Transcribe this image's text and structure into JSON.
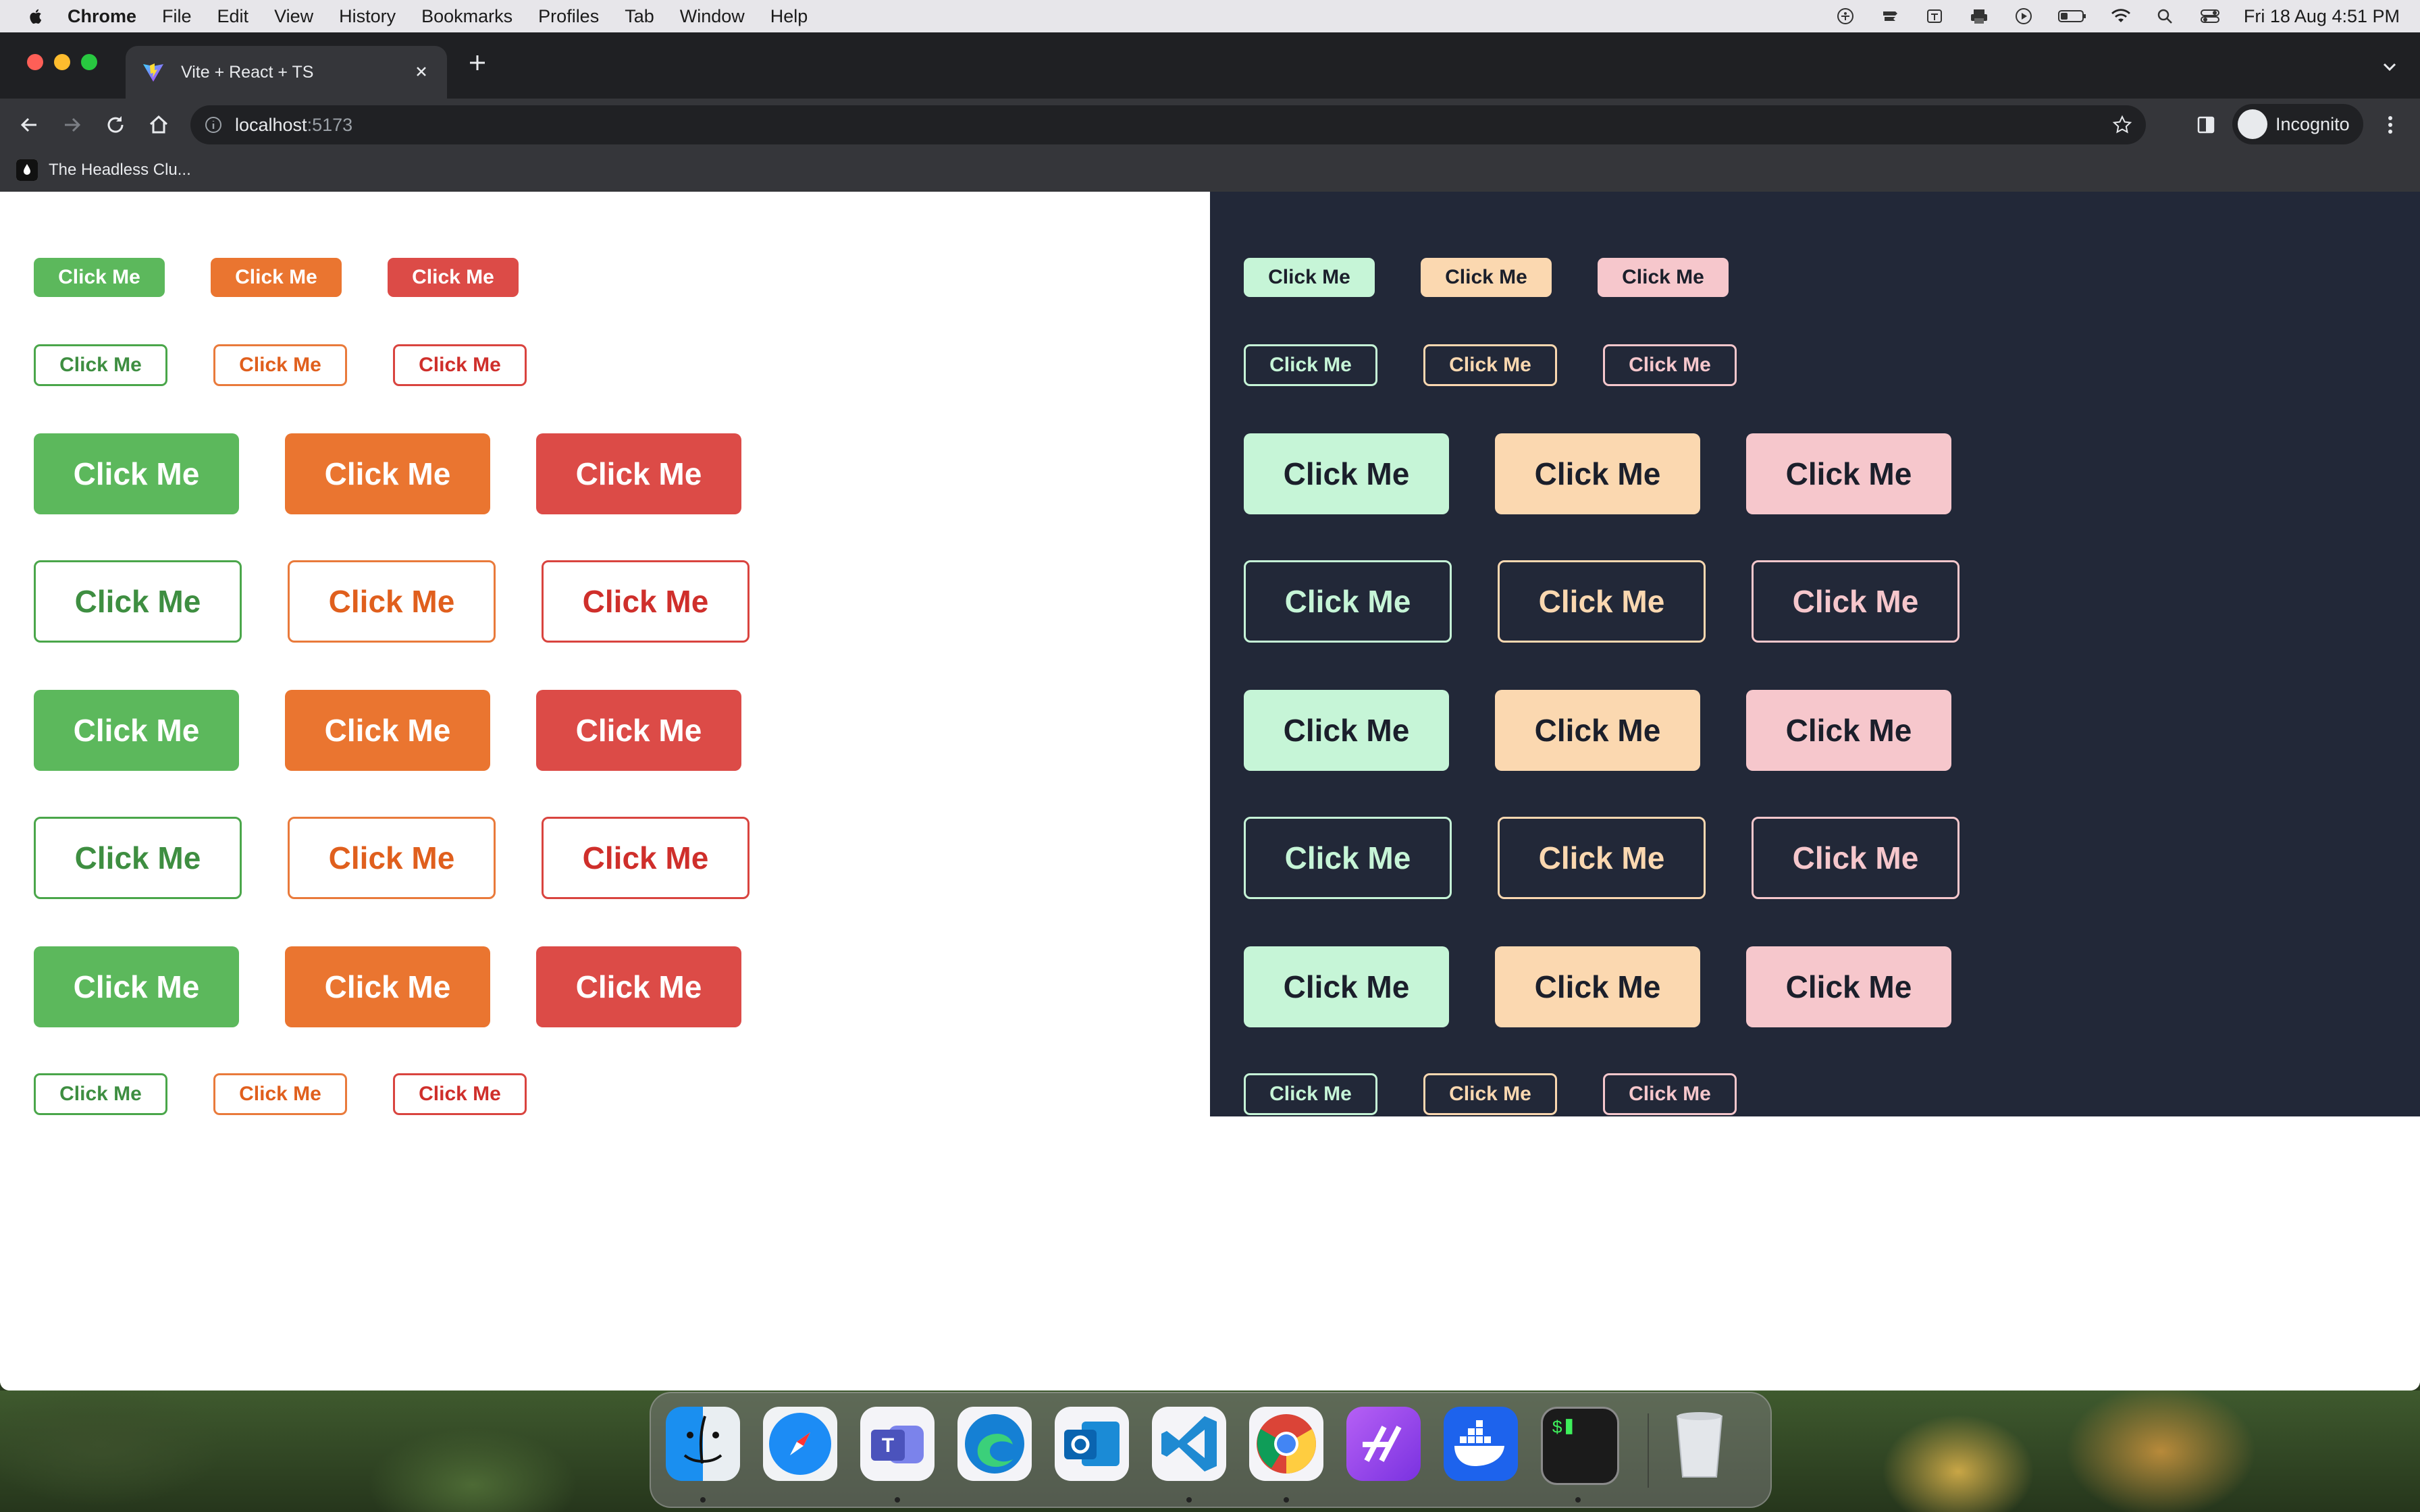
{
  "menubar": {
    "app": "Chrome",
    "items": [
      "File",
      "Edit",
      "View",
      "History",
      "Bookmarks",
      "Profiles",
      "Tab",
      "Window",
      "Help"
    ],
    "clock": "Fri 18 Aug  4:51 PM"
  },
  "browser": {
    "tab_title": "Vite + React + TS",
    "url_host": "localhost",
    "url_port": ":5173",
    "profile_label": "Incognito",
    "bookmark": "The Headless Clu..."
  },
  "button_label": "Click Me",
  "light_panel": {
    "rows": [
      {
        "size": "xs",
        "variant": "solid"
      },
      {
        "size": "sm",
        "variant": "outline"
      },
      {
        "size": "lg",
        "variant": "solid"
      },
      {
        "size": "lg",
        "variant": "outline"
      },
      {
        "size": "lg",
        "variant": "solid"
      },
      {
        "size": "lg",
        "variant": "outline"
      },
      {
        "size": "lg",
        "variant": "solid"
      },
      {
        "size": "sm",
        "variant": "outline"
      }
    ],
    "colors": {
      "green": "#5cb85c",
      "orange": "#ea7530",
      "red": "#dc4b47"
    }
  },
  "dark_panel": {
    "background": "#222838",
    "colors": {
      "green": "#c6f5d7",
      "orange": "#fbd8b0",
      "red": "#f6c7cc"
    }
  },
  "dock": {
    "apps": [
      "finder-icon",
      "safari-icon",
      "teams-icon",
      "edge-icon",
      "outlook-icon",
      "vscode-icon",
      "chrome-icon",
      "postman-icon",
      "docker-icon",
      "terminal-icon",
      "trash-icon"
    ]
  }
}
